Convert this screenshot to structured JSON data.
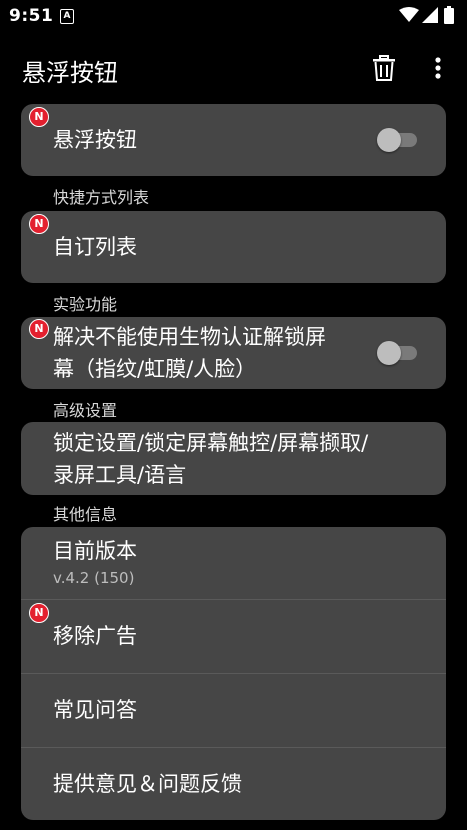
{
  "status_bar": {
    "time": "9:51",
    "notification_glyph": "A",
    "icons": [
      "wifi-icon",
      "signal-icon",
      "battery-icon"
    ]
  },
  "app_bar": {
    "title": "悬浮按钮",
    "actions": [
      "trash-icon",
      "more-vert-icon"
    ]
  },
  "badge_text": "N",
  "colors": {
    "background": "#000000",
    "card": "#464646",
    "badge": "#e3202f",
    "section_header": "#d8d8d8",
    "toggle_track": "#7a7a7a",
    "toggle_thumb": "#bdbdbd"
  },
  "floating_button_card": {
    "label": "悬浮按钮",
    "toggle_on": false,
    "has_badge": true
  },
  "shortcut_section": {
    "header": "快捷方式列表",
    "item_label": "自订列表",
    "has_badge": true
  },
  "experimental_section": {
    "header": "实验功能",
    "item_label_line1": "解决不能使用生物认证解锁屏",
    "item_label_line2": "幕（指纹/虹膜/人脸）",
    "toggle_on": false,
    "has_badge": true
  },
  "advanced_section": {
    "header": "高级设置",
    "item_label_line1": "锁定设置/锁定屏幕触控/屏幕撷取/",
    "item_label_line2": "录屏工具/语言"
  },
  "other_section": {
    "header": "其他信息",
    "version_label": "目前版本",
    "version_value": "v.4.2 (150)",
    "remove_ads_label": "移除广告",
    "faq_label": "常见问答",
    "feedback_label": "提供意见＆问题反馈"
  }
}
